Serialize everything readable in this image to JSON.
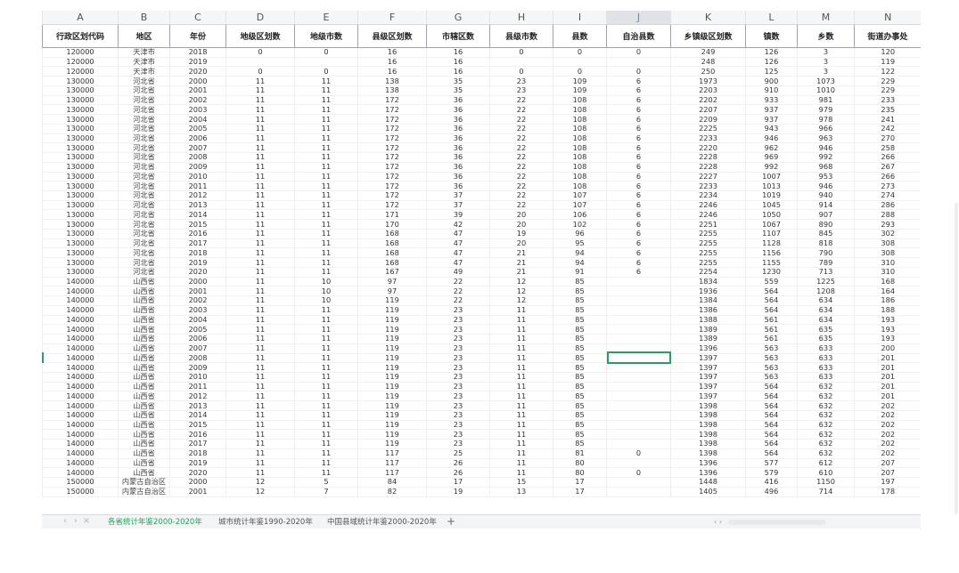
{
  "columns": [
    "A",
    "B",
    "C",
    "D",
    "E",
    "F",
    "G",
    "H",
    "I",
    "J",
    "K",
    "L",
    "M",
    "N"
  ],
  "selected_column": "J",
  "headers": [
    "行政区划代码",
    "地区",
    "年份",
    "地级区划数",
    "地级市数",
    "县级区划数",
    "市辖区数",
    "县级市数",
    "县数",
    "自治县数",
    "乡镇级区划数",
    "镇数",
    "乡数",
    "街道办事处"
  ],
  "rows": [
    [
      "120000",
      "天津市",
      "2018",
      "0",
      "0",
      "16",
      "16",
      "0",
      "0",
      "0",
      "249",
      "126",
      "3",
      "120"
    ],
    [
      "120000",
      "天津市",
      "2019",
      "",
      "",
      "16",
      "16",
      "",
      "",
      "",
      "248",
      "126",
      "3",
      "119"
    ],
    [
      "120000",
      "天津市",
      "2020",
      "0",
      "0",
      "16",
      "16",
      "0",
      "0",
      "0",
      "250",
      "125",
      "3",
      "122"
    ],
    [
      "130000",
      "河北省",
      "2000",
      "11",
      "11",
      "138",
      "35",
      "23",
      "109",
      "6",
      "1973",
      "900",
      "1073",
      "229"
    ],
    [
      "130000",
      "河北省",
      "2001",
      "11",
      "11",
      "138",
      "35",
      "23",
      "109",
      "6",
      "2203",
      "910",
      "1010",
      "229"
    ],
    [
      "130000",
      "河北省",
      "2002",
      "11",
      "11",
      "172",
      "36",
      "22",
      "108",
      "6",
      "2202",
      "933",
      "981",
      "233"
    ],
    [
      "130000",
      "河北省",
      "2003",
      "11",
      "11",
      "172",
      "36",
      "22",
      "108",
      "6",
      "2207",
      "937",
      "979",
      "235"
    ],
    [
      "130000",
      "河北省",
      "2004",
      "11",
      "11",
      "172",
      "36",
      "22",
      "108",
      "6",
      "2209",
      "937",
      "978",
      "241"
    ],
    [
      "130000",
      "河北省",
      "2005",
      "11",
      "11",
      "172",
      "36",
      "22",
      "108",
      "6",
      "2225",
      "943",
      "966",
      "242"
    ],
    [
      "130000",
      "河北省",
      "2006",
      "11",
      "11",
      "172",
      "36",
      "22",
      "108",
      "6",
      "2233",
      "946",
      "963",
      "270"
    ],
    [
      "130000",
      "河北省",
      "2007",
      "11",
      "11",
      "172",
      "36",
      "22",
      "108",
      "6",
      "2220",
      "962",
      "946",
      "258"
    ],
    [
      "130000",
      "河北省",
      "2008",
      "11",
      "11",
      "172",
      "36",
      "22",
      "108",
      "6",
      "2228",
      "969",
      "992",
      "266"
    ],
    [
      "130000",
      "河北省",
      "2009",
      "11",
      "11",
      "172",
      "36",
      "22",
      "108",
      "6",
      "2228",
      "992",
      "968",
      "267"
    ],
    [
      "130000",
      "河北省",
      "2010",
      "11",
      "11",
      "172",
      "36",
      "22",
      "108",
      "6",
      "2227",
      "1007",
      "953",
      "266"
    ],
    [
      "130000",
      "河北省",
      "2011",
      "11",
      "11",
      "172",
      "36",
      "22",
      "108",
      "6",
      "2233",
      "1013",
      "946",
      "273"
    ],
    [
      "130000",
      "河北省",
      "2012",
      "11",
      "11",
      "172",
      "37",
      "22",
      "107",
      "6",
      "2234",
      "1019",
      "940",
      "274"
    ],
    [
      "130000",
      "河北省",
      "2013",
      "11",
      "11",
      "172",
      "37",
      "22",
      "107",
      "6",
      "2246",
      "1045",
      "914",
      "286"
    ],
    [
      "130000",
      "河北省",
      "2014",
      "11",
      "11",
      "171",
      "39",
      "20",
      "106",
      "6",
      "2246",
      "1050",
      "907",
      "288"
    ],
    [
      "130000",
      "河北省",
      "2015",
      "11",
      "11",
      "170",
      "42",
      "20",
      "102",
      "6",
      "2251",
      "1067",
      "890",
      "293"
    ],
    [
      "130000",
      "河北省",
      "2016",
      "11",
      "11",
      "168",
      "47",
      "19",
      "96",
      "6",
      "2255",
      "1107",
      "845",
      "302"
    ],
    [
      "130000",
      "河北省",
      "2017",
      "11",
      "11",
      "168",
      "47",
      "20",
      "95",
      "6",
      "2255",
      "1128",
      "818",
      "308"
    ],
    [
      "130000",
      "河北省",
      "2018",
      "11",
      "11",
      "168",
      "47",
      "21",
      "94",
      "6",
      "2255",
      "1156",
      "790",
      "308"
    ],
    [
      "130000",
      "河北省",
      "2019",
      "11",
      "11",
      "168",
      "47",
      "21",
      "94",
      "6",
      "2255",
      "1155",
      "789",
      "310"
    ],
    [
      "130000",
      "河北省",
      "2020",
      "11",
      "11",
      "167",
      "49",
      "21",
      "91",
      "6",
      "2254",
      "1230",
      "713",
      "310"
    ],
    [
      "140000",
      "山西省",
      "2000",
      "11",
      "10",
      "97",
      "22",
      "12",
      "85",
      "",
      "1834",
      "559",
      "1225",
      "168"
    ],
    [
      "140000",
      "山西省",
      "2001",
      "11",
      "10",
      "97",
      "22",
      "12",
      "85",
      "",
      "1936",
      "564",
      "1208",
      "164"
    ],
    [
      "140000",
      "山西省",
      "2002",
      "11",
      "10",
      "119",
      "22",
      "12",
      "85",
      "",
      "1384",
      "564",
      "634",
      "186"
    ],
    [
      "140000",
      "山西省",
      "2003",
      "11",
      "11",
      "119",
      "23",
      "11",
      "85",
      "",
      "1386",
      "564",
      "634",
      "188"
    ],
    [
      "140000",
      "山西省",
      "2004",
      "11",
      "11",
      "119",
      "23",
      "11",
      "85",
      "",
      "1388",
      "561",
      "634",
      "193"
    ],
    [
      "140000",
      "山西省",
      "2005",
      "11",
      "11",
      "119",
      "23",
      "11",
      "85",
      "",
      "1389",
      "561",
      "635",
      "193"
    ],
    [
      "140000",
      "山西省",
      "2006",
      "11",
      "11",
      "119",
      "23",
      "11",
      "85",
      "",
      "1389",
      "561",
      "635",
      "193"
    ],
    [
      "140000",
      "山西省",
      "2007",
      "11",
      "11",
      "119",
      "23",
      "11",
      "85",
      "",
      "1396",
      "563",
      "633",
      "200"
    ],
    [
      "140000",
      "山西省",
      "2008",
      "11",
      "11",
      "119",
      "23",
      "11",
      "85",
      "",
      "1397",
      "563",
      "633",
      "201"
    ],
    [
      "140000",
      "山西省",
      "2009",
      "11",
      "11",
      "119",
      "23",
      "11",
      "85",
      "",
      "1397",
      "563",
      "633",
      "201"
    ],
    [
      "140000",
      "山西省",
      "2010",
      "11",
      "11",
      "119",
      "23",
      "11",
      "85",
      "",
      "1397",
      "563",
      "633",
      "201"
    ],
    [
      "140000",
      "山西省",
      "2011",
      "11",
      "11",
      "119",
      "23",
      "11",
      "85",
      "",
      "1397",
      "564",
      "632",
      "201"
    ],
    [
      "140000",
      "山西省",
      "2012",
      "11",
      "11",
      "119",
      "23",
      "11",
      "85",
      "",
      "1397",
      "564",
      "632",
      "201"
    ],
    [
      "140000",
      "山西省",
      "2013",
      "11",
      "11",
      "119",
      "23",
      "11",
      "85",
      "",
      "1398",
      "564",
      "632",
      "202"
    ],
    [
      "140000",
      "山西省",
      "2014",
      "11",
      "11",
      "119",
      "23",
      "11",
      "85",
      "",
      "1398",
      "564",
      "632",
      "202"
    ],
    [
      "140000",
      "山西省",
      "2015",
      "11",
      "11",
      "119",
      "23",
      "11",
      "85",
      "",
      "1398",
      "564",
      "632",
      "202"
    ],
    [
      "140000",
      "山西省",
      "2016",
      "11",
      "11",
      "119",
      "23",
      "11",
      "85",
      "",
      "1398",
      "564",
      "632",
      "202"
    ],
    [
      "140000",
      "山西省",
      "2017",
      "11",
      "11",
      "119",
      "23",
      "11",
      "85",
      "",
      "1398",
      "564",
      "632",
      "202"
    ],
    [
      "140000",
      "山西省",
      "2018",
      "11",
      "11",
      "117",
      "25",
      "11",
      "81",
      "0",
      "1398",
      "564",
      "632",
      "202"
    ],
    [
      "140000",
      "山西省",
      "2019",
      "11",
      "11",
      "117",
      "26",
      "11",
      "80",
      "",
      "1396",
      "577",
      "612",
      "207"
    ],
    [
      "140000",
      "山西省",
      "2020",
      "11",
      "11",
      "117",
      "26",
      "11",
      "80",
      "0",
      "1396",
      "579",
      "610",
      "207"
    ],
    [
      "150000",
      "内蒙古自治区",
      "2000",
      "12",
      "5",
      "84",
      "17",
      "15",
      "17",
      "",
      "1448",
      "416",
      "1150",
      "197"
    ],
    [
      "150000",
      "内蒙古自治区",
      "2001",
      "12",
      "7",
      "82",
      "19",
      "13",
      "17",
      "",
      "1405",
      "496",
      "714",
      "178"
    ]
  ],
  "sheet_tabs": [
    "各省统计年鉴2000-2020年",
    "城市统计年鉴1990-2020年",
    "中国县域统计年鉴2000-2020年"
  ],
  "active_tab": 0,
  "nav_icons": [
    "chevron-left-icon",
    "chevron-right-icon",
    "close-icon"
  ],
  "add_tab_symbol": "+",
  "accent_color": "#2e9b64"
}
